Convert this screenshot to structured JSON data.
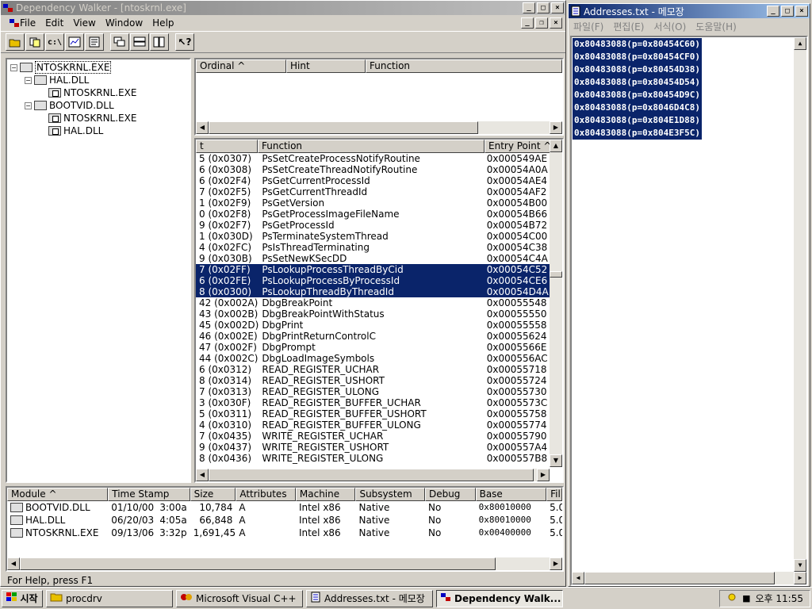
{
  "depwalker": {
    "title": "Dependency Walker - [ntoskrnl.exe]",
    "menu": [
      "File",
      "Edit",
      "View",
      "Window",
      "Help"
    ],
    "tree": [
      {
        "label": "NTOSKRNL.EXE",
        "level": 0,
        "expander": "−"
      },
      {
        "label": "HAL.DLL",
        "level": 1,
        "expander": "−"
      },
      {
        "label": "NTOSKRNL.EXE",
        "level": 2,
        "expander": ""
      },
      {
        "label": "BOOTVID.DLL",
        "level": 1,
        "expander": "−"
      },
      {
        "label": "NTOSKRNL.EXE",
        "level": 2,
        "expander": ""
      },
      {
        "label": "HAL.DLL",
        "level": 2,
        "expander": ""
      }
    ],
    "import_headers": [
      "Ordinal ^",
      "Hint",
      "Function"
    ],
    "export_headers": [
      "t",
      "Function",
      "Entry Point ^"
    ],
    "exports": [
      {
        "ord": "5  (0x0307)",
        "fn": "PsSetCreateProcessNotifyRoutine",
        "ep": "0x000549AE",
        "sel": false
      },
      {
        "ord": "6  (0x0308)",
        "fn": "PsSetCreateThreadNotifyRoutine",
        "ep": "0x00054A0A",
        "sel": false
      },
      {
        "ord": "6  (0x02F4)",
        "fn": "PsGetCurrentProcessId",
        "ep": "0x00054AE4",
        "sel": false
      },
      {
        "ord": "7  (0x02F5)",
        "fn": "PsGetCurrentThreadId",
        "ep": "0x00054AF2",
        "sel": false
      },
      {
        "ord": "1  (0x02F9)",
        "fn": "PsGetVersion",
        "ep": "0x00054B00",
        "sel": false
      },
      {
        "ord": "0  (0x02F8)",
        "fn": "PsGetProcessImageFileName",
        "ep": "0x00054B66",
        "sel": false
      },
      {
        "ord": "9  (0x02F7)",
        "fn": "PsGetProcessId",
        "ep": "0x00054B72",
        "sel": false
      },
      {
        "ord": "1  (0x030D)",
        "fn": "PsTerminateSystemThread",
        "ep": "0x00054C00",
        "sel": false
      },
      {
        "ord": "4  (0x02FC)",
        "fn": "PsIsThreadTerminating",
        "ep": "0x00054C38",
        "sel": false
      },
      {
        "ord": "9  (0x030B)",
        "fn": "PsSetNewKSecDD",
        "ep": "0x00054C4A",
        "sel": false
      },
      {
        "ord": "7  (0x02FF)",
        "fn": "PsLookupProcessThreadByCid",
        "ep": "0x00054C52",
        "sel": true
      },
      {
        "ord": "6  (0x02FE)",
        "fn": "PsLookupProcessByProcessId",
        "ep": "0x00054CE6",
        "sel": true
      },
      {
        "ord": "8  (0x0300)",
        "fn": "PsLookupThreadByThreadId",
        "ep": "0x00054D4A",
        "sel": true
      },
      {
        "ord": "42  (0x002A)",
        "fn": "DbgBreakPoint",
        "ep": "0x00055548",
        "sel": false
      },
      {
        "ord": "43  (0x002B)",
        "fn": "DbgBreakPointWithStatus",
        "ep": "0x00055550",
        "sel": false
      },
      {
        "ord": "45  (0x002D)",
        "fn": "DbgPrint",
        "ep": "0x00055558",
        "sel": false
      },
      {
        "ord": "46  (0x002E)",
        "fn": "DbgPrintReturnControlC",
        "ep": "0x00055624",
        "sel": false
      },
      {
        "ord": "47  (0x002F)",
        "fn": "DbgPrompt",
        "ep": "0x0005566E",
        "sel": false
      },
      {
        "ord": "44  (0x002C)",
        "fn": "DbgLoadImageSymbols",
        "ep": "0x000556AC",
        "sel": false
      },
      {
        "ord": "6  (0x0312)",
        "fn": "READ_REGISTER_UCHAR",
        "ep": "0x00055718",
        "sel": false
      },
      {
        "ord": "8  (0x0314)",
        "fn": "READ_REGISTER_USHORT",
        "ep": "0x00055724",
        "sel": false
      },
      {
        "ord": "7  (0x0313)",
        "fn": "READ_REGISTER_ULONG",
        "ep": "0x00055730",
        "sel": false
      },
      {
        "ord": "3  (0x030F)",
        "fn": "READ_REGISTER_BUFFER_UCHAR",
        "ep": "0x0005573C",
        "sel": false
      },
      {
        "ord": "5  (0x0311)",
        "fn": "READ_REGISTER_BUFFER_USHORT",
        "ep": "0x00055758",
        "sel": false
      },
      {
        "ord": "4  (0x0310)",
        "fn": "READ_REGISTER_BUFFER_ULONG",
        "ep": "0x00055774",
        "sel": false
      },
      {
        "ord": "7  (0x0435)",
        "fn": "WRITE_REGISTER_UCHAR",
        "ep": "0x00055790",
        "sel": false
      },
      {
        "ord": "9  (0x0437)",
        "fn": "WRITE_REGISTER_USHORT",
        "ep": "0x000557A4",
        "sel": false
      },
      {
        "ord": "8  (0x0436)",
        "fn": "WRITE_REGISTER_ULONG",
        "ep": "0x000557B8",
        "sel": false
      }
    ],
    "module_headers": [
      "Module ^",
      "Time Stamp",
      "Size",
      "Attributes",
      "Machine",
      "Subsystem",
      "Debug",
      "Base",
      "Fil"
    ],
    "modules": [
      {
        "name": "BOOTVID.DLL",
        "date": "01/10/00",
        "time": "3:00a",
        "size": "10,784",
        "attr": "A",
        "machine": "Intel x86",
        "subsystem": "Native",
        "debug": "No",
        "base": "0x80010000",
        "fil": "5.0"
      },
      {
        "name": "HAL.DLL",
        "date": "06/20/03",
        "time": "4:05a",
        "size": "66,848",
        "attr": "A",
        "machine": "Intel x86",
        "subsystem": "Native",
        "debug": "No",
        "base": "0x80010000",
        "fil": "5.0"
      },
      {
        "name": "NTOSKRNL.EXE",
        "date": "09/13/06",
        "time": "3:32p",
        "size": "1,691,456",
        "attr": "A",
        "machine": "Intel x86",
        "subsystem": "Native",
        "debug": "No",
        "base": "0x00400000",
        "fil": "5.0"
      }
    ],
    "status": "For Help, press F1"
  },
  "notepad": {
    "title": "Addresses.txt - 메모장",
    "menu": [
      "파일(F)",
      "편집(E)",
      "서식(O)",
      "도움말(H)"
    ],
    "lines": [
      "0x80483088(p=0x80454C60)",
      "0x80483088(p=0x80454CF0)",
      "0x80483088(p=0x80454D38)",
      "0x80483088(p=0x80454D54)",
      "0x80483088(p=0x80454D9C)",
      "0x80483088(p=0x8046D4C8)",
      "0x80483088(p=0x804E1D88)",
      "0x80483088(p=0x804E3F5C)"
    ]
  },
  "taskbar": {
    "start": "시작",
    "tasks": [
      {
        "label": "procdrv",
        "active": false
      },
      {
        "label": "Microsoft Visual C++",
        "active": false
      },
      {
        "label": "Addresses.txt - 메모장",
        "active": false
      },
      {
        "label": "Dependency Walk...",
        "active": true
      }
    ],
    "clock": "오후 11:55"
  }
}
